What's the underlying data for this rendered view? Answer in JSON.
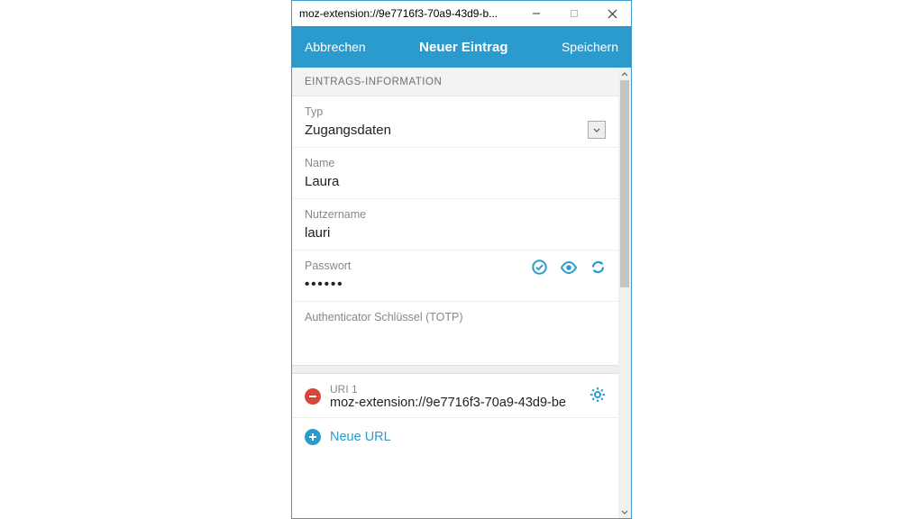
{
  "window": {
    "title": "moz-extension://9e7716f3-70a9-43d9-b..."
  },
  "header": {
    "cancel": "Abbrechen",
    "title": "Neuer Eintrag",
    "save": "Speichern"
  },
  "section": {
    "info_title": "EINTRAGS-INFORMATION"
  },
  "fields": {
    "type_label": "Typ",
    "type_value": "Zugangsdaten",
    "name_label": "Name",
    "name_value": "Laura",
    "username_label": "Nutzername",
    "username_value": "lauri",
    "password_label": "Passwort",
    "password_value": "••••••",
    "totp_label": "Authenticator Schlüssel (TOTP)",
    "totp_value": ""
  },
  "uri": {
    "label": "URI 1",
    "value": "moz-extension://9e7716f3-70a9-43d9-be"
  },
  "add_url_label": "Neue URL",
  "colors": {
    "accent": "#2b9bce"
  }
}
